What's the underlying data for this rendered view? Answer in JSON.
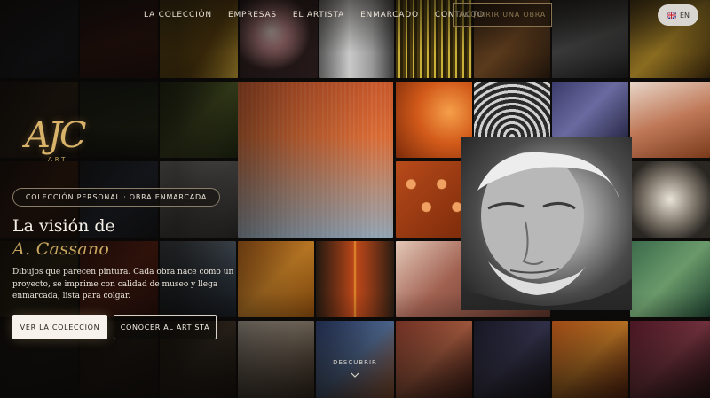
{
  "nav": {
    "items": [
      {
        "label": "LA COLECCIÓN"
      },
      {
        "label": "EMPRESAS"
      },
      {
        "label": "EL ARTISTA"
      },
      {
        "label": "ENMARCADO"
      },
      {
        "label": "CONTACTO"
      }
    ],
    "cta_label": "ADQUIRIR UNA OBRA",
    "language": "EN"
  },
  "logo": {
    "mark": "AJC",
    "sub": "ART"
  },
  "hero": {
    "badge": "COLECCIÓN PERSONAL · OBRA ENMARCADA",
    "headline": "La visión de",
    "artist_name": "A. Cassano",
    "description": "Dibujos que parecen pintura. Cada obra nace como un proyecto, se imprime con calidad de museo y llega enmarcada, lista para colgar.",
    "primary_button": "VER LA COLECCIÓN",
    "secondary_button": "CONOCER AL ARTISTA",
    "discover_label": "DESCUBRIR"
  },
  "colors": {
    "accent_gold": "#c9a65e",
    "background": "#0d0b0a"
  },
  "icons": {
    "flag": "uk-flag-icon",
    "scroll": "chevron-down-icon"
  }
}
